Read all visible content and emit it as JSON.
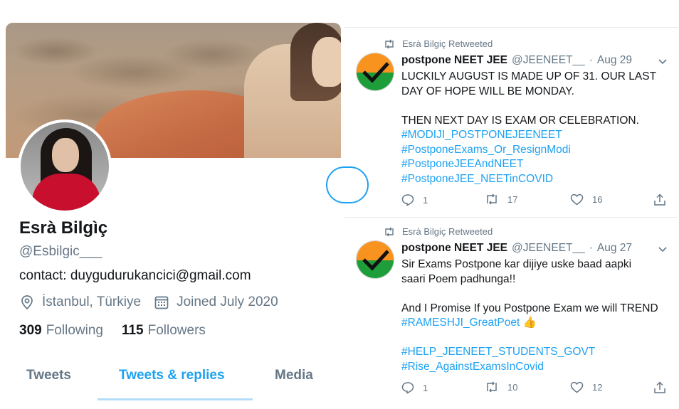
{
  "profile": {
    "display_name": "Esrà Bilgìç",
    "handle": "@Esbilgic___",
    "bio": "contact: duygudurukancici@gmail.com",
    "location": "İstanbul, Türkiye",
    "joined": "Joined July 2020",
    "following_count": "309",
    "following_label": "Following",
    "followers_count": "115",
    "followers_label": "Followers",
    "icons": {
      "location": "location-pin-icon",
      "joined": "calendar-icon"
    }
  },
  "tabs": [
    {
      "label": "Tweets",
      "active": false
    },
    {
      "label": "Tweets & replies",
      "active": true
    },
    {
      "label": "Media",
      "active": false
    }
  ],
  "tweets": [
    {
      "retweet_label": "Esrà Bilgiç Retweeted",
      "name": "postpone NEET JEE",
      "handle": "@JEENEET__",
      "separator": "·",
      "date": "Aug 29",
      "lines": {
        "l1": "LUCKILY AUGUST IS MADE UP OF 31. OUR LAST",
        "l2": "DAY OF HOPE WILL BE MONDAY.",
        "l3": "THEN NEXT DAY IS EXAM OR CELEBRATION."
      },
      "hashtags": [
        "#MODIJI_POSTPONEJEENEET",
        "#PostponeExams_Or_ResignModi",
        "#PostponeJEEAndNEET",
        "#PostponeJEE_NEETinCOVID"
      ],
      "replies": "1",
      "retweets": "17",
      "likes": "16"
    },
    {
      "retweet_label": "Esrà Bilgiç Retweeted",
      "name": "postpone NEET JEE",
      "handle": "@JEENEET__",
      "separator": "·",
      "date": "Aug 27",
      "lines": {
        "l1": "Sir Exams Postpone kar dijiye uske baad aapki",
        "l2": "saari Poem padhunga!!",
        "l3": "And I Promise If you Postpone Exam we will TREND"
      },
      "hashtag_inline": "#RAMESHJI_GreatPoet",
      "emoji": "👍",
      "hashtags": [
        "#HELP_JEENEET_STUDENTS_GOVT",
        "#Rise_AgainstExamsInCovid"
      ],
      "replies": "1",
      "retweets": "10",
      "likes": "12"
    }
  ],
  "colors": {
    "accent": "#1da1f2",
    "muted": "#657786",
    "text": "#14171a",
    "avatar_orange": "#f7931e",
    "avatar_green": "#1e9e3a"
  },
  "action_icons": [
    "reply-icon",
    "retweet-icon",
    "like-icon",
    "share-icon"
  ]
}
